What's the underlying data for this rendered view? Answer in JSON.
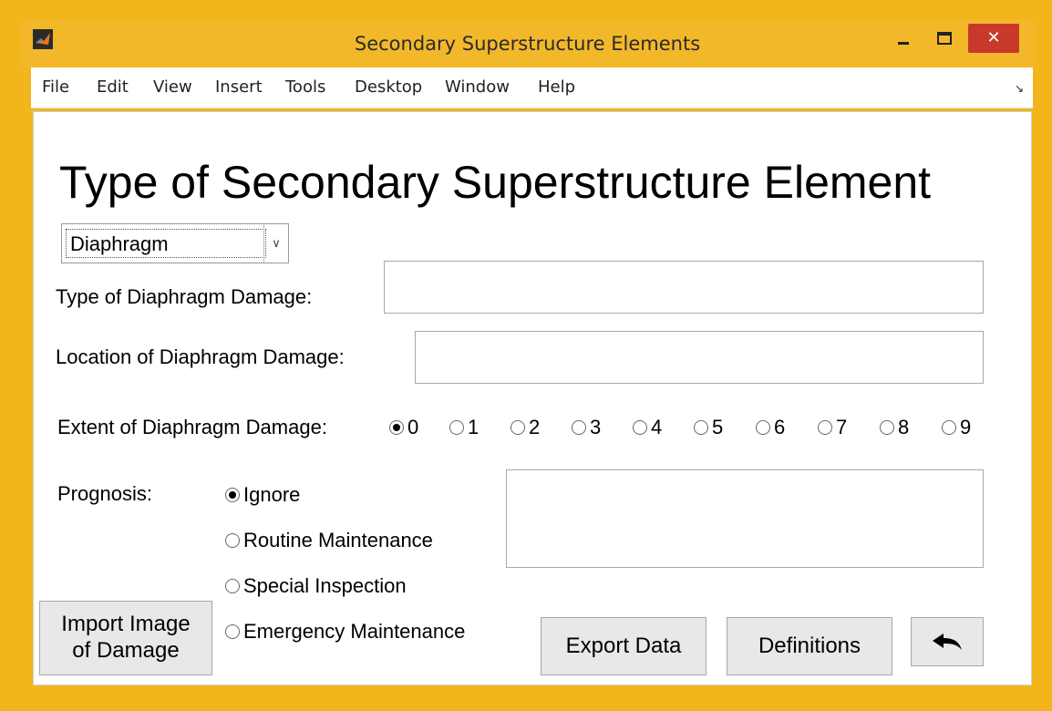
{
  "window": {
    "title": "Secondary Superstructure Elements",
    "close_glyph": "✕"
  },
  "menu": [
    "File",
    "Edit",
    "View",
    "Insert",
    "Tools",
    "Desktop",
    "Window",
    "Help"
  ],
  "heading": "Type of Secondary Superstructure Element",
  "element_select": {
    "value": "Diaphragm"
  },
  "damage_type": {
    "label": "Type of Diaphragm Damage:",
    "value": ""
  },
  "damage_location": {
    "label": "Location of Diaphragm Damage:",
    "value": ""
  },
  "extent": {
    "label": "Extent of Diaphragm Damage:",
    "options": [
      "0",
      "1",
      "2",
      "3",
      "4",
      "5",
      "6",
      "7",
      "8",
      "9"
    ],
    "selected": "0"
  },
  "prognosis": {
    "label": "Prognosis:",
    "options": [
      "Ignore",
      "Routine Maintenance",
      "Special Inspection",
      "Emergency Maintenance"
    ],
    "selected": "Ignore",
    "notes_value": ""
  },
  "buttons": {
    "import_line1": "Import Image",
    "import_line2": "of Damage",
    "export": "Export Data",
    "definitions": "Definitions"
  },
  "icons": {
    "app": "matlab-icon",
    "minimize": "minimize-icon",
    "maximize": "maximize-icon",
    "close": "close-icon",
    "dock": "dock-icon",
    "back": "back-arrow-icon"
  },
  "colors": {
    "title_bar": "#f3b82a",
    "close_button": "#c9392b"
  }
}
